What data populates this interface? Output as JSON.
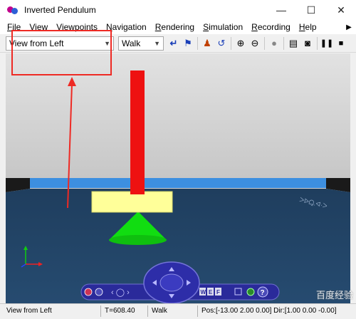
{
  "window": {
    "title": "Inverted Pendulum"
  },
  "menu": {
    "items": [
      {
        "first": "F",
        "rest": "ile"
      },
      {
        "first": "V",
        "rest": "iew"
      },
      {
        "first": "V",
        "rest": "iewpoints"
      },
      {
        "first": "N",
        "rest": "avigation"
      },
      {
        "first": "R",
        "rest": "endering"
      },
      {
        "first": "S",
        "rest": "imulation"
      },
      {
        "first": "R",
        "rest": "ecording"
      },
      {
        "first": "H",
        "rest": "elp"
      }
    ]
  },
  "toolbar": {
    "viewpoint_value": "View from Left",
    "navigation_value": "Walk"
  },
  "scene": {
    "text_on_floor": "ᐳᐅᗝ̱.ᐊ·ᐳ"
  },
  "navigator": {
    "buttons": [
      "W",
      "E",
      "F"
    ],
    "help": "?"
  },
  "status": {
    "viewpoint": "View from Left",
    "time": "T=608.40",
    "mode": "Walk",
    "pos": "Pos:[-13.00 2.00 0.00] Dir:[1.00 0.00 -0.00]"
  },
  "watermark": "百度经验"
}
